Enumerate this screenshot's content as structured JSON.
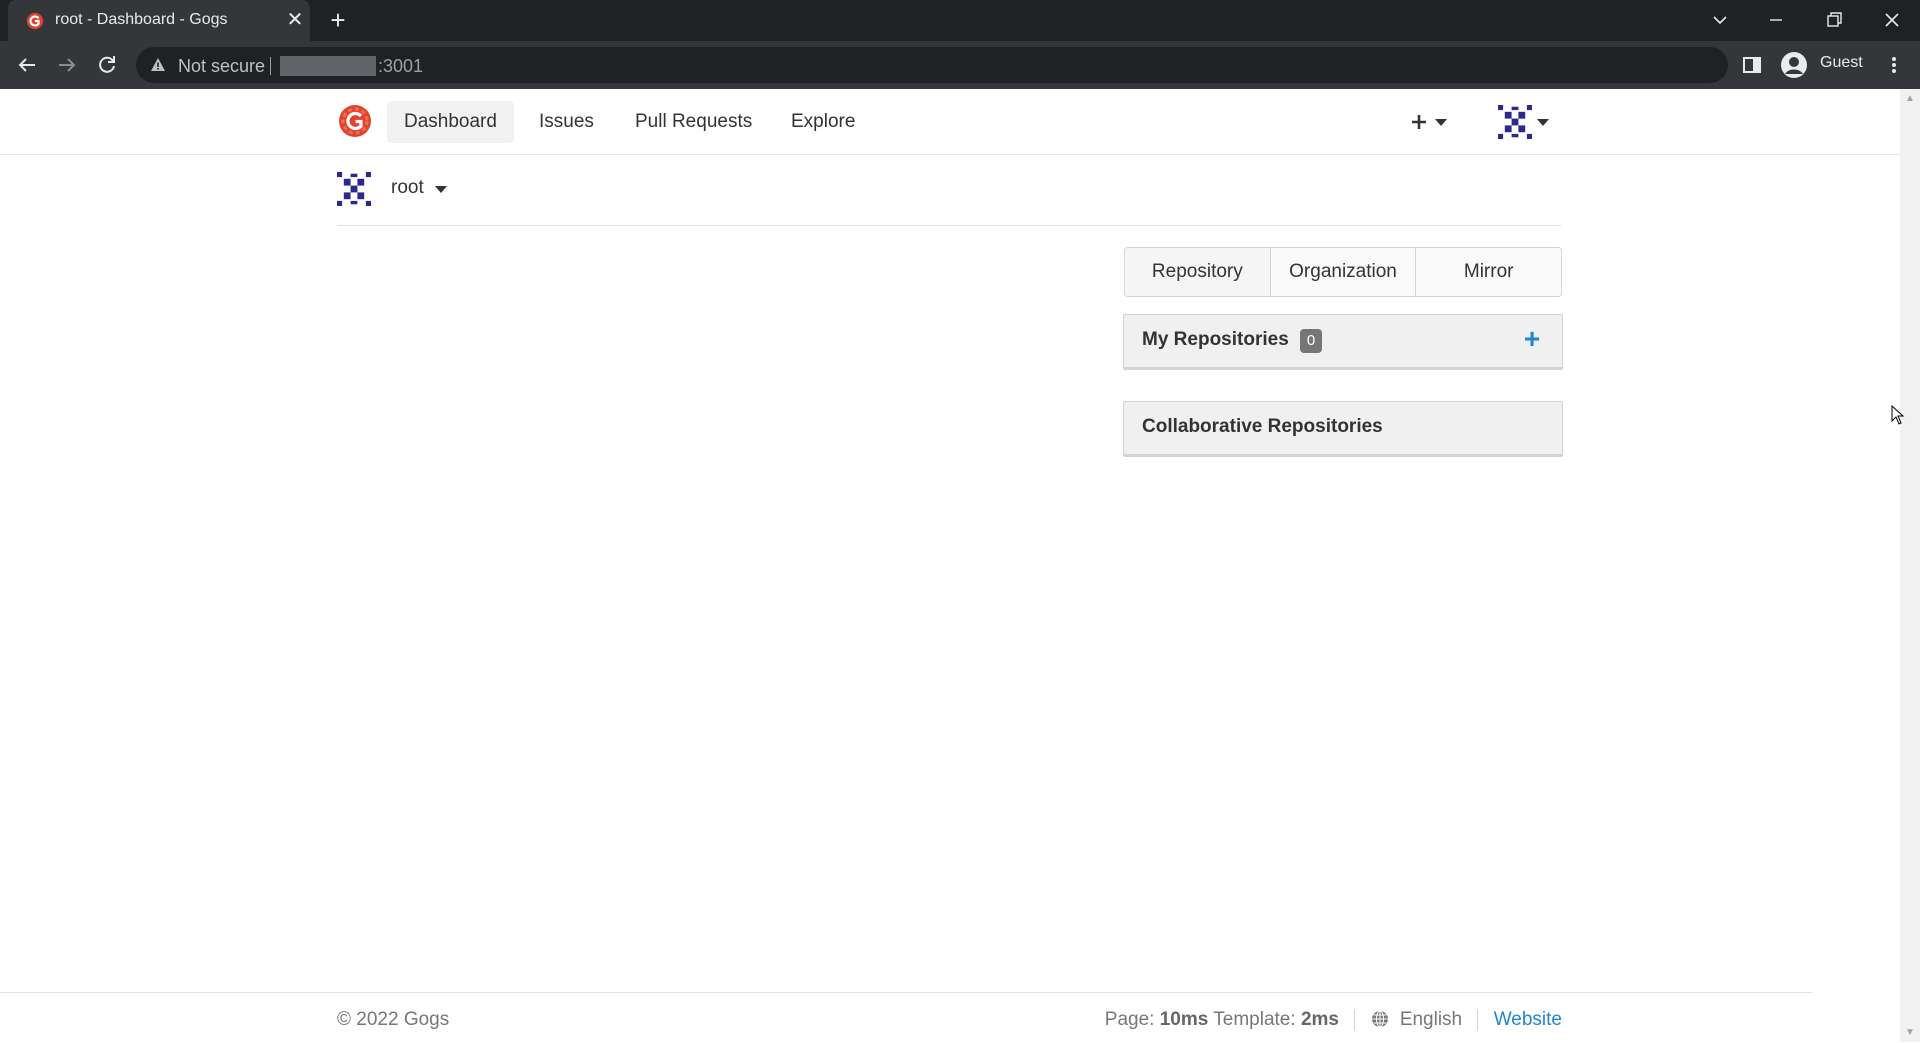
{
  "browser": {
    "tab_title": "root - Dashboard - Gogs",
    "tab_close_glyph": "✕",
    "new_tab_glyph": "+",
    "not_secure_label": "Not secure",
    "port_text": ":3001",
    "profile_label": "Guest",
    "icons": [
      "gogs-favicon",
      "back-icon",
      "forward-icon",
      "reload-icon",
      "warning-icon",
      "side-panel-icon",
      "profile-icon",
      "kebab-menu-icon",
      "tab-search-icon",
      "minimize-icon",
      "restore-icon",
      "close-icon"
    ]
  },
  "nav": {
    "items": [
      {
        "label": "Dashboard",
        "active": true
      },
      {
        "label": "Issues",
        "active": false
      },
      {
        "label": "Pull Requests",
        "active": false
      },
      {
        "label": "Explore",
        "active": false
      }
    ],
    "create_glyph": "+"
  },
  "context": {
    "user_name": "root"
  },
  "new_menu": {
    "repository": "Repository",
    "organization": "Organization",
    "mirror": "Mirror"
  },
  "panels": {
    "my_repos": {
      "title": "My Repositories",
      "count": "0",
      "add_glyph": "+"
    },
    "collab_repos": {
      "title": "Collaborative Repositories"
    }
  },
  "footer": {
    "copyright": "© 2022 Gogs",
    "page_label": "Page:",
    "page_time": "10ms",
    "template_label": "Template:",
    "template_time": "2ms",
    "language": "English",
    "website": "Website"
  },
  "colors": {
    "accent": "#2185d0",
    "gogs_logo": "#e0442f",
    "identicon": "#2b2a8c"
  }
}
